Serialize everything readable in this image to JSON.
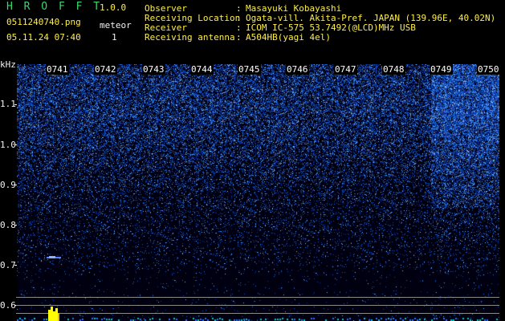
{
  "app": {
    "name": "H R O F F T",
    "version": "1.0.0",
    "filename": "0511240740.png",
    "datetime": "05.11.24 07:40",
    "meteor_label": "meteor",
    "meteor_count": "1"
  },
  "info": {
    "rows": [
      {
        "label": "Observer",
        "sep": ":",
        "value": "Masayuki Kobayashi"
      },
      {
        "label": "Receiving Location",
        "sep": ":",
        "value": "Ogata-vill. Akita-Pref. JAPAN (139.96E, 40.02N)"
      },
      {
        "label": "Receiver",
        "sep": ":",
        "value": "ICOM IC-575 53.7492(@LCD)MHz USB"
      },
      {
        "label": "Receiving antenna",
        "sep": ":",
        "value": "A504HB(yagi 4el)"
      }
    ]
  },
  "axis": {
    "unit": "kHz",
    "y_labels": [
      "1.1",
      "1.0",
      "0.9",
      "0.8",
      "0.7",
      "0.6"
    ],
    "time_labels": [
      "0741",
      "0742",
      "0743",
      "0744",
      "0745",
      "0746",
      "0747",
      "0748",
      "0749",
      "0750"
    ]
  },
  "colors": {
    "header_green": "#39d76b",
    "version_yellow": "#ffee44",
    "text_white": "#f2f2f2",
    "spectro_blue": "#2a4bd8",
    "meteor_yellow": "#ffff00",
    "baseline_cyan": "#00c8c8"
  }
}
